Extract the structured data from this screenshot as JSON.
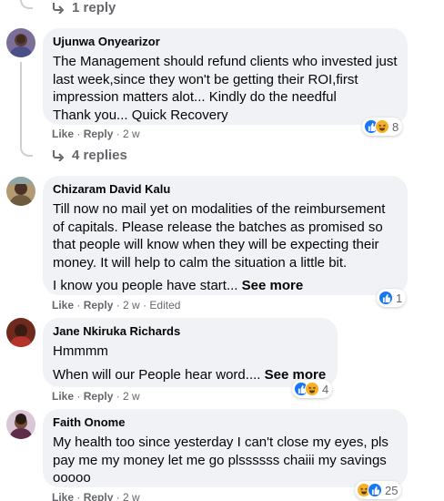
{
  "top_replies": {
    "label": "1 reply"
  },
  "comments": [
    {
      "author": "Ujunwa Onyearizor",
      "text": "The Management should refund clients who invested just last week,since they won't be getting their ROI,first impression matters alot... Kindly do the needful\nThank you... Quick Recovery",
      "reaction_count": "8",
      "actions": {
        "like": "Like",
        "reply": "Reply",
        "time": "2 w"
      },
      "replies": "4 replies"
    },
    {
      "author": "Chizaram David Kalu",
      "text": "Till now no mail yet on modalities of the reimbursement of capitals. Please release the batches as promised so that people will know when they will be expecting their money. It will help to calm the situation a little bit.",
      "text2": "I know you people have start...",
      "see_more": "See more",
      "reaction_count": "1",
      "actions": {
        "like": "Like",
        "reply": "Reply",
        "time": "2 w",
        "edited": "Edited"
      }
    },
    {
      "author": "Jane Nkiruka Richards",
      "text": "Hmmmm",
      "text2": "When will our People hear word....",
      "see_more": "See more",
      "reaction_count": "4",
      "actions": {
        "like": "Like",
        "reply": "Reply",
        "time": "2 w"
      }
    },
    {
      "author": "Faith Onome",
      "text": "My health too since yesterday I can't close my eyes, pls pay me my money let me go plssssss chaiii my savings ooooo",
      "reaction_count": "25",
      "actions": {
        "like": "Like",
        "reply": "Reply",
        "time": "2 w"
      }
    }
  ],
  "colors": {
    "bubble": "#f0f2f5",
    "meta": "#65676b",
    "like": "#1877f2",
    "haha": "#f7b125"
  }
}
